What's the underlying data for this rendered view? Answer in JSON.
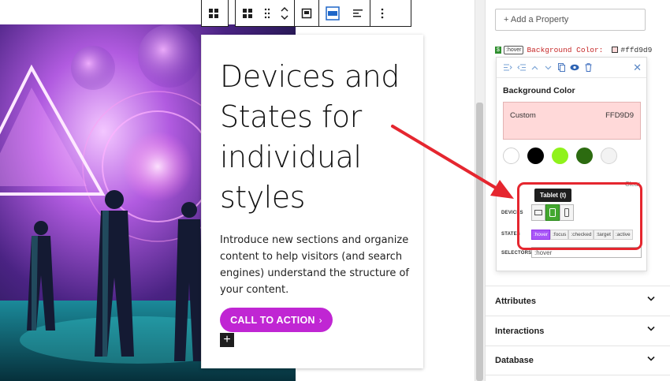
{
  "colors": {
    "accent": "#c026d3",
    "annotation": "#e5262f",
    "background_value": "#ffd9d9",
    "active_device": "#43a72f",
    "active_state": "#a855f7"
  },
  "hero_image": {
    "icon": "abstract-futuristic-illustration"
  },
  "block_toolbar": {
    "icons": [
      "parent-block-icon",
      "block-grid-icon",
      "drag-handle-icon",
      "move-up-down-icon",
      "block-style-icon",
      "layout-icon",
      "align-icon",
      "more-options-icon"
    ]
  },
  "card": {
    "heading": "Devices and States for individual styles",
    "body": "Introduce new sections and organize content to help visitors (and search engines) understand the structure of your content.",
    "cta_label": "CALL TO ACTION",
    "cta_chevron": "›",
    "add_block_label": "+"
  },
  "sidebar": {
    "add_property_label": "+ Add a Property",
    "property_row": {
      "state_tag": ":hover",
      "name": "Background Color:",
      "value": "#ffd9d9"
    },
    "popover": {
      "title": "Background Color",
      "custom_label": "Custom",
      "hex_value": "FFD9D9",
      "swatches": [
        "#ffffff",
        "#000000",
        "#8ff21b",
        "#2c6b10",
        "#f3f3f3"
      ],
      "clear_label": "Clear",
      "tooltip": "Tablet (t)",
      "devices_label": "DEVICES",
      "states_label": "STATES",
      "selectors_label": "SELECTORS",
      "states": [
        ":hover",
        ":focus",
        ":checked",
        ":target",
        ":active"
      ],
      "selector_value": ":hover"
    },
    "panels": [
      "Attributes",
      "Interactions",
      "Database"
    ]
  }
}
